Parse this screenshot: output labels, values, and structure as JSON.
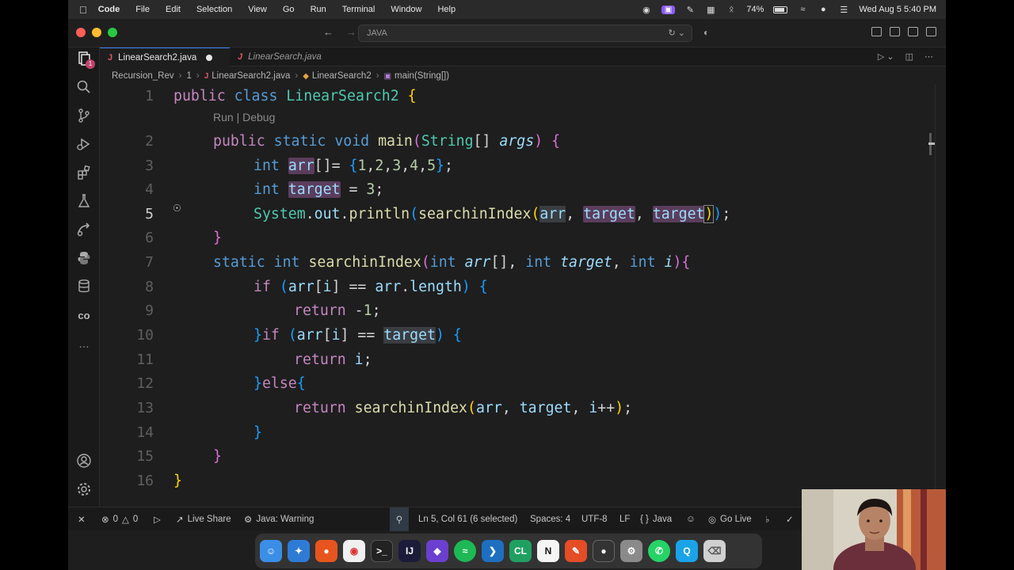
{
  "menubar": {
    "app_name": "Code",
    "items": [
      "File",
      "Edit",
      "Selection",
      "View",
      "Go",
      "Run",
      "Terminal",
      "Window",
      "Help"
    ],
    "battery": "74%",
    "datetime": "Wed Aug 5  5:40 PM"
  },
  "titlebar": {
    "search_text": "JAVA"
  },
  "tabs": [
    {
      "label": "LinearSearch2.java",
      "dirty": true
    },
    {
      "label": "LinearSearch.java",
      "dirty": false
    }
  ],
  "breadcrumb": [
    "Recursion_Rev",
    "1",
    "LinearSearch2.java",
    "LinearSearch2",
    "main(String[])"
  ],
  "codelens": "Run | Debug",
  "line_numbers": [
    "1",
    "2",
    "3",
    "4",
    "5",
    "6",
    "7",
    "8",
    "9",
    "10",
    "11",
    "12",
    "13",
    "14",
    "15",
    "16"
  ],
  "status": {
    "errors": "0",
    "warnings": "0",
    "live_share": "Live Share",
    "java_status": "Java: Warning",
    "cursor": "Ln 5, Col 61 (6 selected)",
    "spaces": "Spaces: 4",
    "encoding": "UTF-8",
    "eol": "LF",
    "language": "Java",
    "go_live": "Go Live"
  },
  "colors": {
    "editor_bg": "#1e1e1e",
    "keyword": "#c586c0",
    "type_keyword": "#569cd6",
    "class_name": "#4ec9b0",
    "function": "#dcdcaa",
    "number": "#b5cea8",
    "parameter": "#9cdcfe",
    "selection_highlight": "#5a3d5c",
    "accent": "#3b82f6"
  }
}
